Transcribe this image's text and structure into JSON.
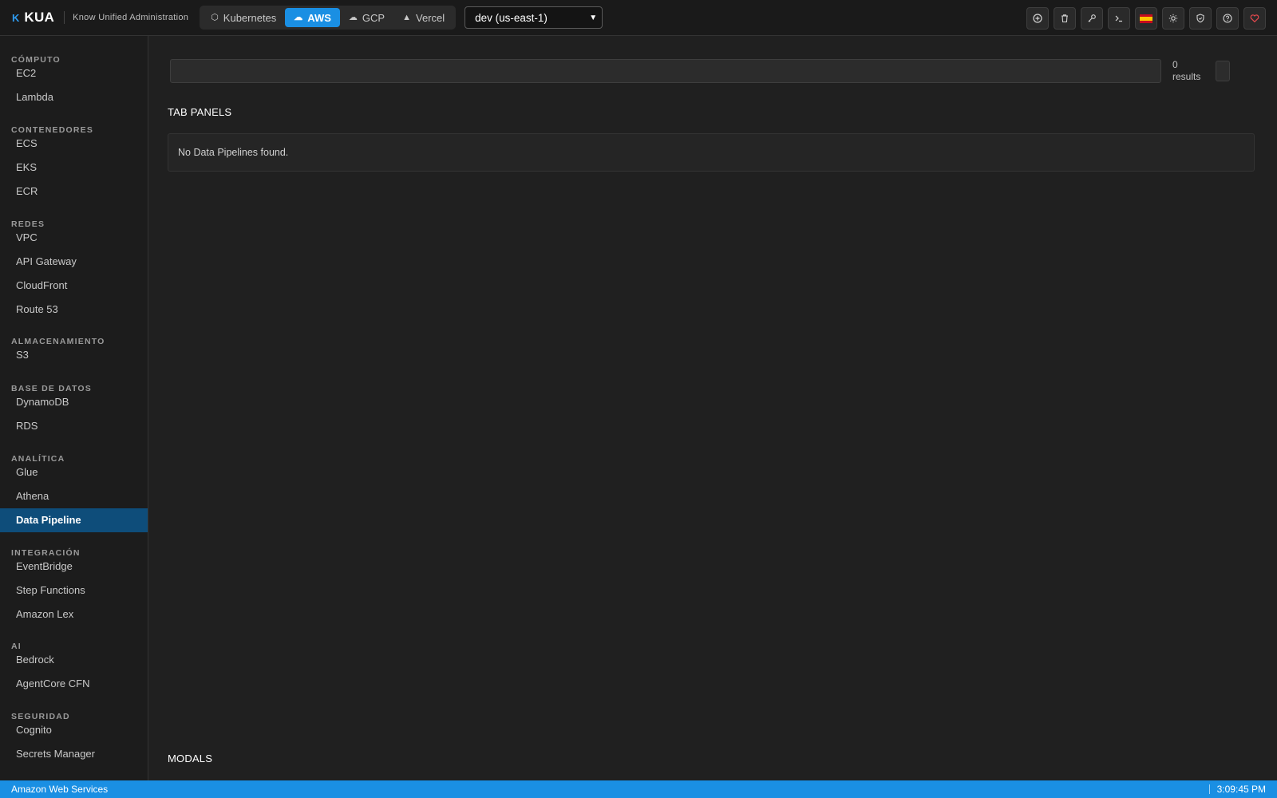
{
  "header": {
    "brand_mark": "K",
    "brand_name": "KUA",
    "tagline": "Know Unified Administration",
    "providers": [
      {
        "label": "Kubernetes",
        "icon": "cube-icon",
        "active": false
      },
      {
        "label": "AWS",
        "icon": "cloud-icon",
        "active": true
      },
      {
        "label": "GCP",
        "icon": "cloud-outline-icon",
        "active": false
      },
      {
        "label": "Vercel",
        "icon": "triangle-icon",
        "active": false
      }
    ],
    "environment": "dev (us-east-1)",
    "toolbar_icons": [
      "add-circle-icon",
      "trash-icon",
      "key-icon",
      "terminal-icon",
      "spain-flag-icon",
      "sun-icon",
      "shield-icon",
      "help-icon",
      "heart-icon"
    ]
  },
  "sidebar": {
    "sections": [
      {
        "title": "CÓMPUTO",
        "items": [
          "EC2",
          "Lambda"
        ]
      },
      {
        "title": "CONTENEDORES",
        "items": [
          "ECS",
          "EKS",
          "ECR"
        ]
      },
      {
        "title": "REDES",
        "items": [
          "VPC",
          "API Gateway",
          "CloudFront",
          "Route 53"
        ]
      },
      {
        "title": "ALMACENAMIENTO",
        "items": [
          "S3"
        ]
      },
      {
        "title": "BASE DE DATOS",
        "items": [
          "DynamoDB",
          "RDS"
        ]
      },
      {
        "title": "ANALÍTICA",
        "items": [
          "Glue",
          "Athena",
          "Data Pipeline"
        ]
      },
      {
        "title": "INTEGRACIÓN",
        "items": [
          "EventBridge",
          "Step Functions",
          "Amazon Lex"
        ]
      },
      {
        "title": "AI",
        "items": [
          "Bedrock",
          "AgentCore CFN"
        ]
      },
      {
        "title": "SEGURIDAD",
        "items": [
          "Cognito",
          "Secrets Manager"
        ]
      }
    ],
    "active_item": "Data Pipeline"
  },
  "main": {
    "search_value": "",
    "results_count": "0",
    "results_label": "results",
    "tab_panels_heading": "TAB PANELS",
    "empty_message": "No Data Pipelines found.",
    "modals_heading": "MODALS"
  },
  "status": {
    "left": "Amazon Web Services",
    "time": "3:09:45 PM"
  },
  "colors": {
    "accent": "#1a8fe3",
    "active_nav": "#0e4d7a",
    "heart": "#e5484d"
  }
}
